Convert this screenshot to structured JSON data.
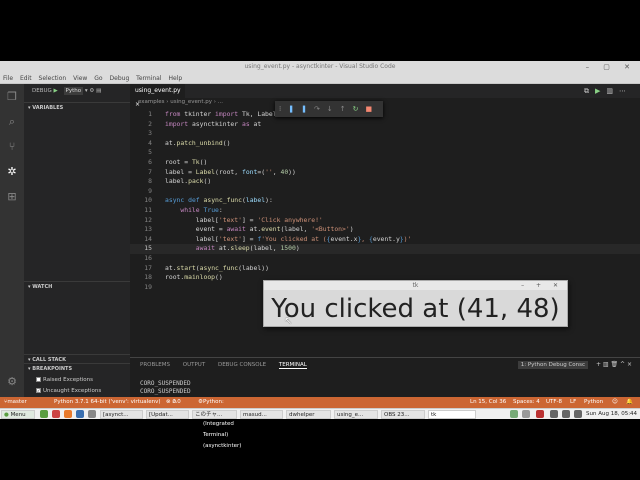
{
  "window": {
    "title": "using_event.py - asynctkinter - Visual Studio Code"
  },
  "menu": [
    "File",
    "Edit",
    "Selection",
    "View",
    "Go",
    "Debug",
    "Terminal",
    "Help"
  ],
  "debug": {
    "label": "DEBUG",
    "config": "Pytho"
  },
  "sidebar": {
    "sections": [
      "VARIABLES",
      "WATCH",
      "CALL STACK",
      "BREAKPOINTS"
    ],
    "breakpoints": [
      {
        "label": "Raised Exceptions",
        "checked": false
      },
      {
        "label": "Uncaught Exceptions",
        "checked": true
      }
    ]
  },
  "editor": {
    "tab": "using_event.py",
    "breadcrumb": "examples › using_event.py › ...",
    "current_line": 15,
    "lines": [
      "from tkinter import Tk, Label",
      "import asynctkinter as at",
      "",
      "at.patch_unbind()",
      "",
      "root = Tk()",
      "label = Label(root, font=('', 40))",
      "label.pack()",
      "",
      "async def async_func(label):",
      "    while True:",
      "        label['text'] = 'Click anywhere!'",
      "        event = await at.event(label, '<Button>')",
      "        label['text'] = f'You clicked at ({event.x}, {event.y})'",
      "        await at.sleep(label, 1500)",
      "",
      "at.start(async_func(label))",
      "root.mainloop()",
      ""
    ]
  },
  "panel": {
    "tabs": [
      "PROBLEMS",
      "OUTPUT",
      "DEBUG CONSOLE",
      "TERMINAL"
    ],
    "active_tab": "TERMINAL",
    "terminal_select": "1: Python Debug Consc",
    "terminal_lines": [
      "CORO_SUSPENDED",
      "CORO_SUSPENDED"
    ]
  },
  "status": {
    "branch": "master",
    "interpreter": "Python 3.7.1 64-bit ('venv': virtualenv)",
    "errors": "0",
    "warnings": "0",
    "launch": "Python: Current File (Integrated Terminal) (asynctkinter)",
    "position": "Ln 15, Col 36",
    "spaces": "Spaces: 4",
    "encoding": "UTF-8",
    "eol": "LF",
    "language": "Python"
  },
  "taskbar": {
    "menu": "Menu",
    "items": [
      "[asynct...",
      "[Updat...",
      "このチャ...",
      "masud...",
      "dwhelper",
      "using_e...",
      "OBS 23...",
      "tk"
    ],
    "clock": "Sun Aug 18, 05:44"
  },
  "tk_window": {
    "title": "tk",
    "label": "You clicked at (41, 48)"
  }
}
